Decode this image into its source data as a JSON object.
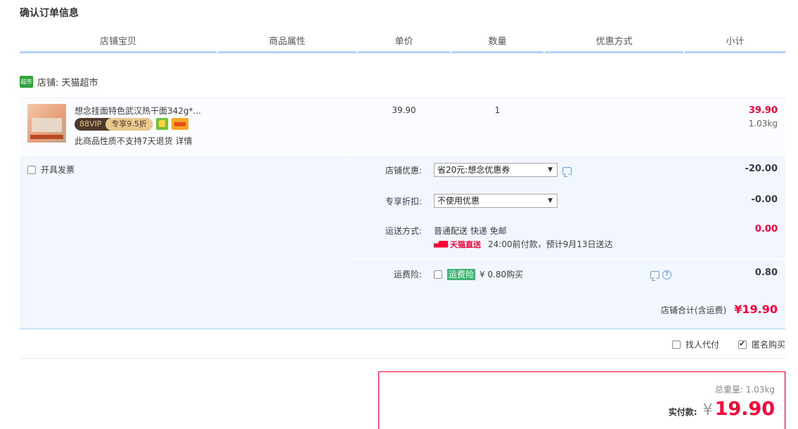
{
  "page_title": "确认订单信息",
  "table_headers": [
    "店铺宝贝",
    "商品属性",
    "单价",
    "数量",
    "优惠方式",
    "小计"
  ],
  "shop": {
    "badge_text": "超市",
    "label": "店铺: 天猫超市"
  },
  "item": {
    "title": "想念挂面特色武汉热干面342g*...",
    "vip_left": "88VIP",
    "vip_right": "专享9.5折",
    "note": "此商品性质不支持7天退货 详情",
    "price": "39.90",
    "quantity": "1",
    "subtotal": "39.90",
    "weight": "1.03kg"
  },
  "invoice_label": "开具发票",
  "options": {
    "store_discount_label": "店铺优惠:",
    "store_discount_selected": "省20元:想念优惠券",
    "store_discount_amount": "-20.00",
    "exclusive_discount_label": "专享折扣:",
    "exclusive_discount_selected": "不使用优惠",
    "exclusive_discount_amount": "-0.00",
    "shipping_label": "运送方式:",
    "shipping_method": "普通配送 快递 免邮",
    "tmall_direct": "天猫直送",
    "shipping_eta": "24:00前付款，预计9月13日送达",
    "shipping_amount": "0.00",
    "insurance_label": "运费险:",
    "insurance_tag": "运费险",
    "insurance_price": "¥ 0.80购买",
    "insurance_amount": "0.80",
    "help_glyph": "?"
  },
  "shop_total": {
    "label": "店铺合计(含运费)",
    "value": "¥19.90"
  },
  "extras": {
    "find_payer": "找人代付",
    "anonymous": "匿名购买"
  },
  "summary": {
    "total_weight": "总重量: 1.03kg",
    "pay_label": "实付款:",
    "currency": "¥",
    "pay_value": "19.90"
  },
  "colors": {
    "accent_red": "#ff0036",
    "header_underline": "#b2d1ff",
    "options_bg": "#f2f7ff"
  }
}
